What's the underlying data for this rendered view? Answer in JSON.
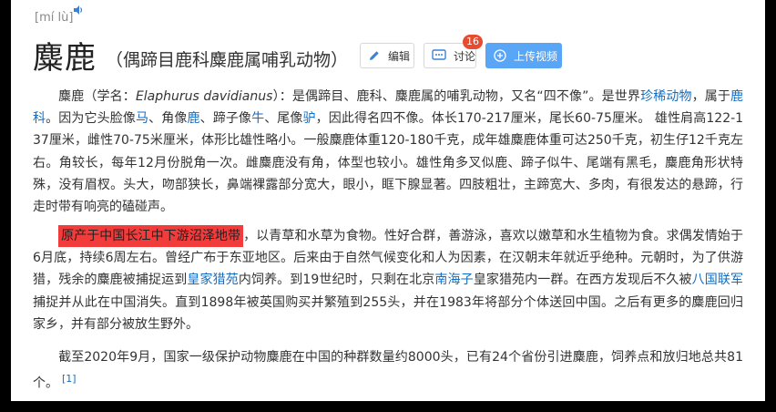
{
  "header": {
    "pinyin": "[mí lù]",
    "title": "麋鹿",
    "subtitle": "（偶蹄目鹿科麋鹿属哺乳动物）",
    "edit_label": "编辑",
    "discuss_label": "讨论",
    "discuss_count": "16",
    "upload_label": "上传视频",
    "icons": [
      "speaker-icon",
      "edit-icon",
      "comment-icon",
      "plus-circle-icon"
    ],
    "colors": {
      "upload_bg": "#59a6f7",
      "badge_bg": "#e64c2f",
      "link": "#136ec2",
      "highlight": "#f23b3b"
    }
  },
  "p1": {
    "t1": "麋鹿（学名：",
    "sci": "Elaphurus davidianus",
    "t2": "）：是偶蹄目、鹿科、麋鹿属的哺乳动物，又名“四不像”。是世界",
    "l1": "珍稀动物",
    "t3": "，属于",
    "l2": "鹿科",
    "t4": "。因为它头脸像",
    "l3": "马",
    "t5": "、角像",
    "l4": "鹿",
    "t6": "、蹄子像",
    "l5": "牛",
    "t7": "、尾像",
    "l6": "驴",
    "t8": "，因此得名四不像。体长170-217厘米，尾长60-75厘米。 雄性肩高122-137厘米，雌性70-75米厘米，体形比雄性略小。一般麋鹿体重120-180千克，成年雄麋鹿体重可达250千克，初生仔12千克左右。角较长，每年12月份脱角一次。雌麋鹿没有角，体型也较小。雄性角多叉似鹿、蹄子似牛、尾端有黑毛，麋鹿角形状特殊，没有眉杈。头大，吻部狭长，鼻端裸露部分宽大，眼小，眶下腺显著。四肢粗壮，主蹄宽大、多肉，有很发达的悬蹄，行走时带有响亮的磕碰声。"
  },
  "p2": {
    "hl": "原产于中国长江中下游沼泽地带",
    "t1": "，以青草和水草为食物。性好合群，善游泳，喜欢以嫩草和水生植物为食。求偶发情始于6月底，持续6周左右。曾经广布于东亚地区。后来由于自然气候变化和人为因素，在汉朝末年就近乎绝种。元朝时，为了供游猎，残余的麋鹿被捕捉运到",
    "l1": "皇家猎苑",
    "t2": "内饲养。到19世纪时，只剩在北京",
    "l2": "南海子",
    "t3": "皇家猎苑内一群。在西方发现后不久被",
    "l3": "八国联军",
    "t4": "捕捉并从此在中国消失。直到1898年被英国购买并繁殖到255头，并在1983年将部分个体送回中国。之后有更多的麋鹿回归家乡，并有部分被放生野外。"
  },
  "p3": {
    "t1": "截至2020年9月，国家一级保护动物麋鹿在中国的种群数量约8000头，已有24个省份引进麋鹿，饲养点和放归地总共81个。",
    "ref": "[1]"
  }
}
